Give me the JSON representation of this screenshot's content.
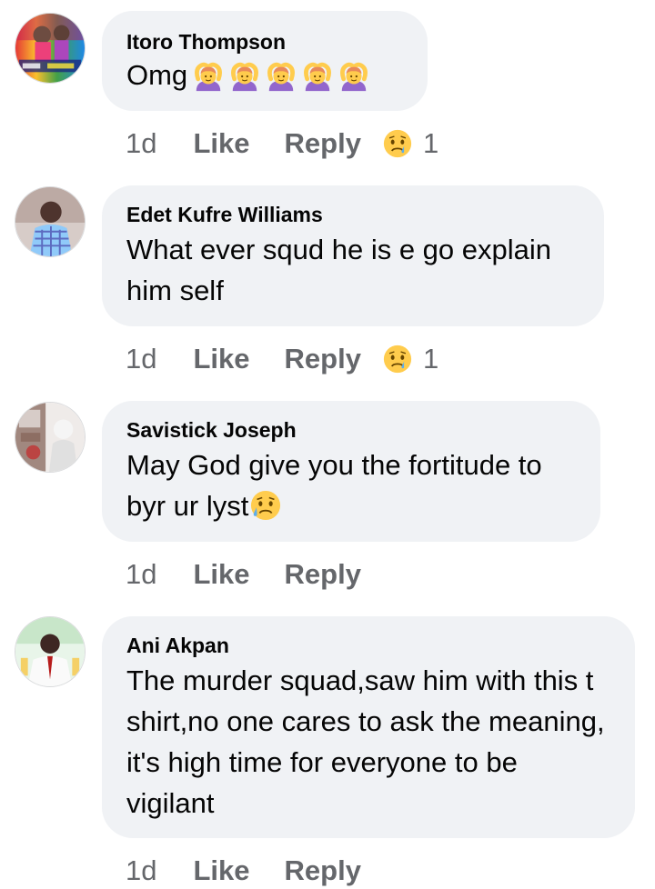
{
  "comments": [
    {
      "author": "Itoro Thompson",
      "text": "Omg",
      "emoji_count": 5,
      "emoji_icon": "woman-gesturing-ok-icon",
      "time": "1d",
      "like_label": "Like",
      "reply_label": "Reply",
      "reaction_icon": "sad-face-icon",
      "reaction_count": "1"
    },
    {
      "author": "Edet Kufre Williams",
      "text": "What ever squd he is e go explain him self",
      "time": "1d",
      "like_label": "Like",
      "reply_label": "Reply",
      "reaction_icon": "sad-face-icon",
      "reaction_count": "1"
    },
    {
      "author": "Savistick Joseph",
      "text": "May God give you the fortitude to byr ur lyst",
      "trailing_emoji": "sad-but-relieved-face-icon",
      "time": "1d",
      "like_label": "Like",
      "reply_label": "Reply"
    },
    {
      "author": "Ani Akpan",
      "text": "The murder squad,saw him with this t shirt,no one cares to ask the meaning, it's high time for everyone to be vigilant",
      "time": "1d",
      "like_label": "Like",
      "reply_label": "Reply"
    }
  ],
  "colors": {
    "bubble": "#f0f2f5",
    "action_text": "#65676b",
    "body_text": "#050505",
    "emoji_yellow": "#ffcc4d",
    "emoji_purple": "#9266cc"
  }
}
